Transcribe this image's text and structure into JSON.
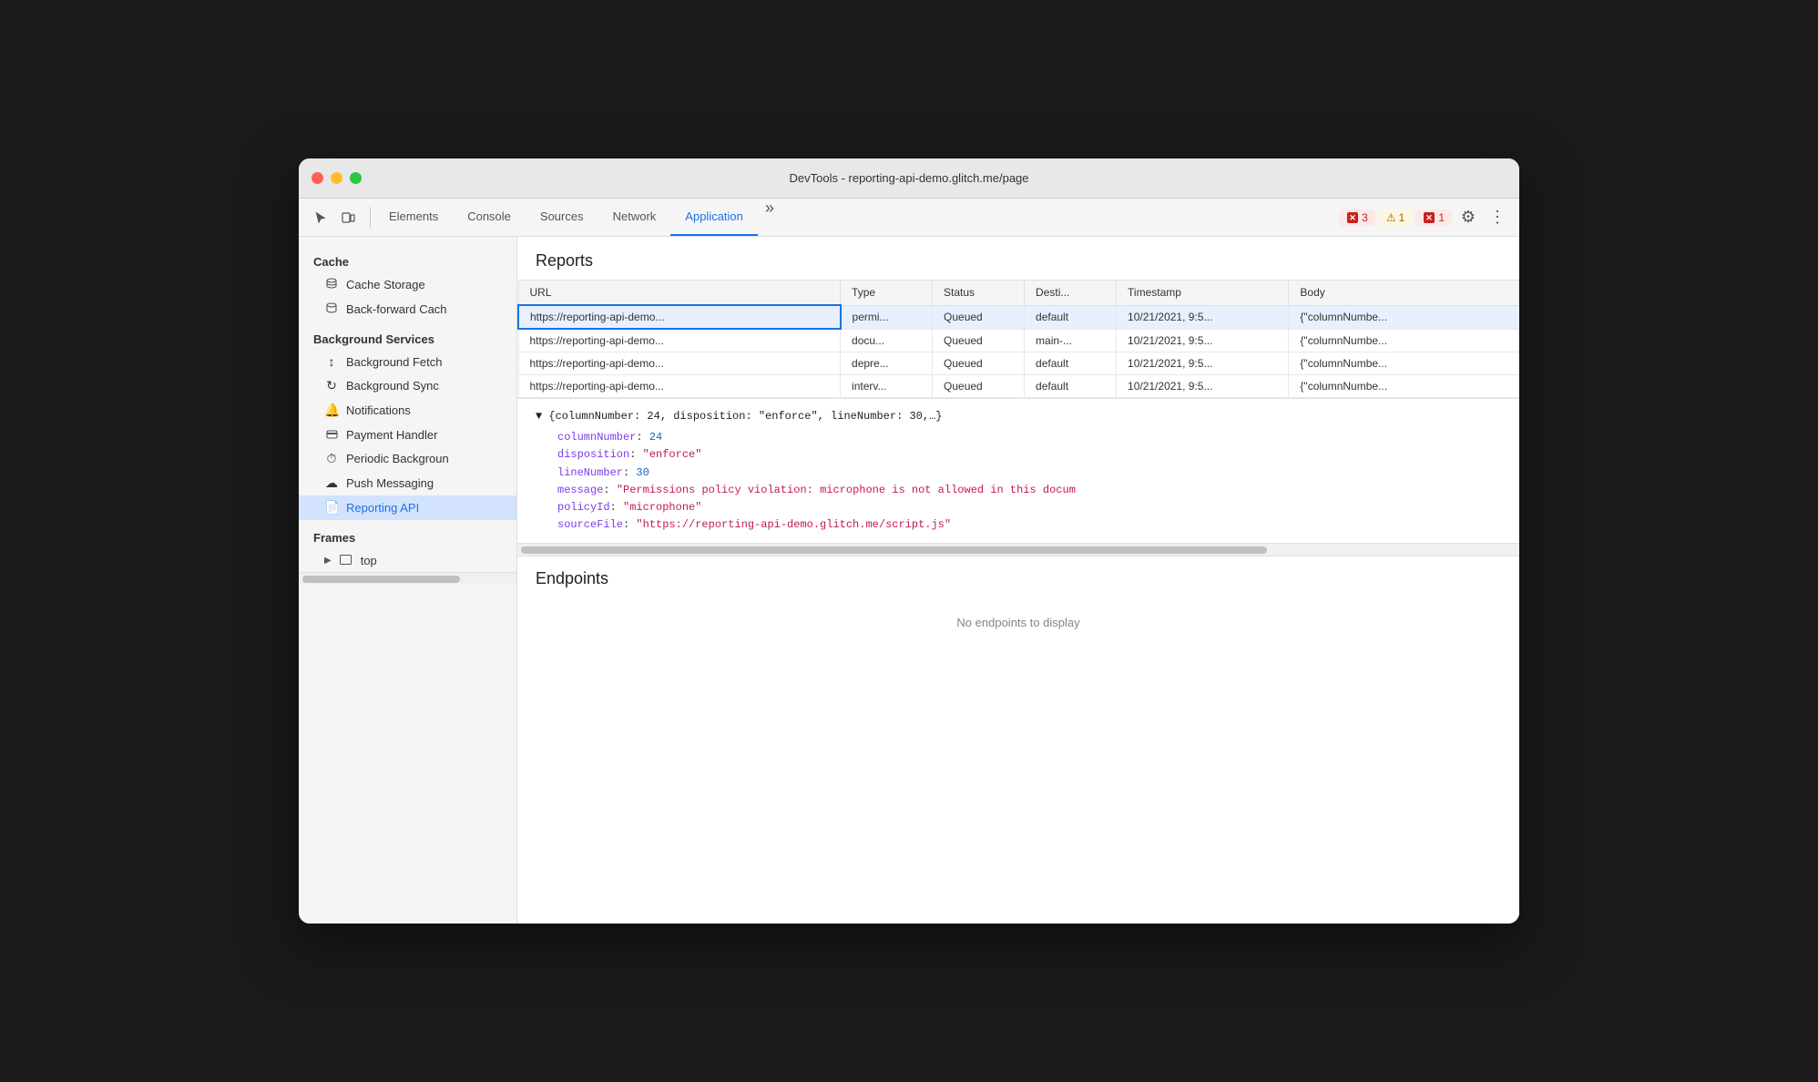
{
  "window": {
    "title": "DevTools - reporting-api-demo.glitch.me/page"
  },
  "toolbar": {
    "tabs": [
      {
        "id": "elements",
        "label": "Elements",
        "active": false
      },
      {
        "id": "console",
        "label": "Console",
        "active": false
      },
      {
        "id": "sources",
        "label": "Sources",
        "active": false
      },
      {
        "id": "network",
        "label": "Network",
        "active": false
      },
      {
        "id": "application",
        "label": "Application",
        "active": true
      }
    ],
    "more_tabs_icon": "»",
    "error_count": "3",
    "warning_count": "1",
    "error_count2": "1",
    "settings_icon": "⚙",
    "more_icon": "⋮"
  },
  "sidebar": {
    "cache_section": "Cache",
    "cache_storage": "Cache Storage",
    "back_forward_cache": "Back-forward Cach",
    "bg_services_section": "Background Services",
    "bg_fetch": "Background Fetch",
    "bg_sync": "Background Sync",
    "notifications": "Notifications",
    "payment_handler": "Payment Handler",
    "periodic_bg": "Periodic Backgroun",
    "push_messaging": "Push Messaging",
    "reporting_api": "Reporting API",
    "frames_section": "Frames",
    "top_frame": "top"
  },
  "content": {
    "reports_heading": "Reports",
    "table": {
      "headers": [
        "URL",
        "Type",
        "Status",
        "Desti...",
        "Timestamp",
        "Body"
      ],
      "rows": [
        {
          "url": "https://reporting-api-demo...",
          "type": "permi...",
          "status": "Queued",
          "dest": "default",
          "timestamp": "10/21/2021, 9:5...",
          "body": "{\"columnNumbe..."
        },
        {
          "url": "https://reporting-api-demo...",
          "type": "docu...",
          "status": "Queued",
          "dest": "main-...",
          "timestamp": "10/21/2021, 9:5...",
          "body": "{\"columnNumbe..."
        },
        {
          "url": "https://reporting-api-demo...",
          "type": "depre...",
          "status": "Queued",
          "dest": "default",
          "timestamp": "10/21/2021, 9:5...",
          "body": "{\"columnNumbe..."
        },
        {
          "url": "https://reporting-api-demo...",
          "type": "interv...",
          "status": "Queued",
          "dest": "default",
          "timestamp": "10/21/2021, 9:5...",
          "body": "{\"columnNumbe..."
        }
      ]
    },
    "json_detail": {
      "summary": "▼ {columnNumber: 24, disposition: \"enforce\", lineNumber: 30,…}",
      "column_number_key": "columnNumber",
      "column_number_val": "24",
      "disposition_key": "disposition",
      "disposition_val": "\"enforce\"",
      "line_number_key": "lineNumber",
      "line_number_val": "30",
      "message_key": "message",
      "message_val": "\"Permissions policy violation: microphone is not allowed in this docum",
      "policy_id_key": "policyId",
      "policy_id_val": "\"microphone\"",
      "source_file_key": "sourceFile",
      "source_file_val": "\"https://reporting-api-demo.glitch.me/script.js\""
    },
    "endpoints_heading": "Endpoints",
    "endpoints_empty": "No endpoints to display"
  },
  "colors": {
    "active_tab": "#1a73e8",
    "selected_row_bg": "#e8f0fe",
    "selected_row_border": "#1a73e8",
    "json_key": "#7c3aed",
    "json_number": "#1565c0",
    "json_string": "#c2185b"
  }
}
